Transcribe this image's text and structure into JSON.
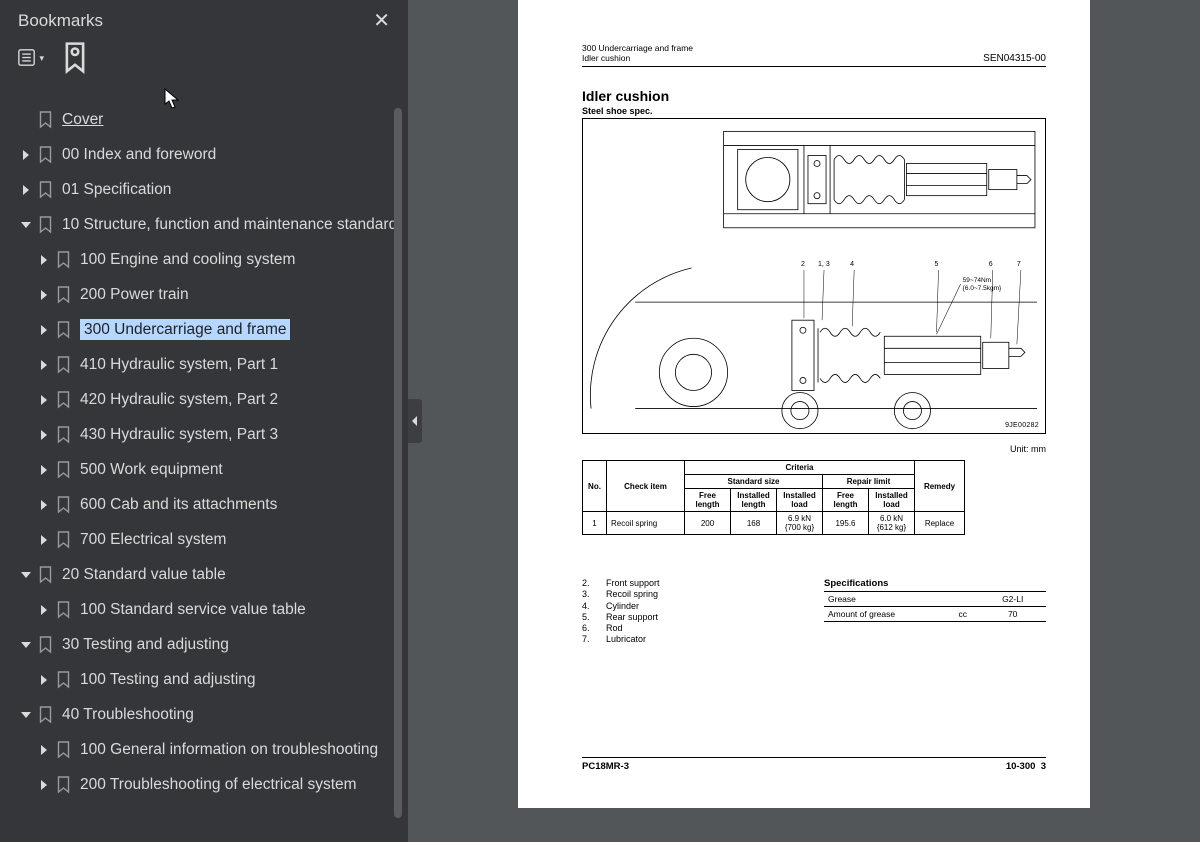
{
  "sidebar": {
    "title": "Bookmarks",
    "nodes": [
      {
        "label": "Cover",
        "indent": 0,
        "arrow": "none",
        "underline": true
      },
      {
        "label": "00 Index and foreword",
        "indent": 0,
        "arrow": "right"
      },
      {
        "label": "01 Specification",
        "indent": 0,
        "arrow": "right"
      },
      {
        "label": "10 Structure, function and maintenance standard",
        "indent": 0,
        "arrow": "down"
      },
      {
        "label": "100 Engine and cooling system",
        "indent": 1,
        "arrow": "right"
      },
      {
        "label": "200 Power train",
        "indent": 1,
        "arrow": "right"
      },
      {
        "label": "300 Undercarriage and frame",
        "indent": 1,
        "arrow": "right",
        "selected": true
      },
      {
        "label": "410 Hydraulic system, Part 1",
        "indent": 1,
        "arrow": "right"
      },
      {
        "label": "420 Hydraulic system, Part 2",
        "indent": 1,
        "arrow": "right"
      },
      {
        "label": "430 Hydraulic system, Part 3",
        "indent": 1,
        "arrow": "right"
      },
      {
        "label": "500 Work equipment",
        "indent": 1,
        "arrow": "right"
      },
      {
        "label": "600 Cab and its attachments",
        "indent": 1,
        "arrow": "right"
      },
      {
        "label": "700 Electrical system",
        "indent": 1,
        "arrow": "right"
      },
      {
        "label": "20 Standard value table",
        "indent": 0,
        "arrow": "down"
      },
      {
        "label": "100 Standard service value table",
        "indent": 1,
        "arrow": "right"
      },
      {
        "label": "30 Testing and adjusting",
        "indent": 0,
        "arrow": "down"
      },
      {
        "label": "100 Testing and adjusting",
        "indent": 1,
        "arrow": "right"
      },
      {
        "label": "40 Troubleshooting",
        "indent": 0,
        "arrow": "down"
      },
      {
        "label": "100 General information on troubleshooting",
        "indent": 1,
        "arrow": "right"
      },
      {
        "label": "200 Troubleshooting of electrical system",
        "indent": 1,
        "arrow": "right"
      }
    ]
  },
  "doc": {
    "header_section": "300 Undercarriage and frame",
    "header_sub": "Idler cushion",
    "header_code": "SEN04315-00",
    "title": "Idler cushion",
    "subtitle": "Steel shoe spec.",
    "torque": "59~74Nm\n{6.0~7.5kgm}",
    "fig_code": "9JE00282",
    "unit_label": "Unit: mm",
    "crit_headers": {
      "no": "No.",
      "check": "Check item",
      "criteria": "Criteria",
      "remedy": "Remedy",
      "std_size": "Standard size",
      "repair": "Repair limit",
      "free_len": "Free length",
      "inst_len": "Installed length",
      "inst_load": "Installed load"
    },
    "crit_row": {
      "no": "1",
      "check": "Recoil spring",
      "free_len": "200",
      "inst_len": "168",
      "inst_load": "6.9 kN {700 kg}",
      "r_free_len": "195.6",
      "r_inst_load": "6.0 kN {612 kg}",
      "remedy": "Replace"
    },
    "parts": [
      {
        "n": "2.",
        "t": "Front support"
      },
      {
        "n": "3.",
        "t": "Recoil spring"
      },
      {
        "n": "4.",
        "t": "Cylinder"
      },
      {
        "n": "5.",
        "t": "Rear support"
      },
      {
        "n": "6.",
        "t": "Rod"
      },
      {
        "n": "7.",
        "t": "Lubricator"
      }
    ],
    "spec_title": "Specifications",
    "spec_rows": [
      {
        "a": "Grease",
        "b": "",
        "c": "G2-LI"
      },
      {
        "a": "Amount of grease",
        "b": "cc",
        "c": "70"
      }
    ],
    "footer_model": "PC18MR-3",
    "footer_page": "10-300",
    "footer_num": "3"
  }
}
